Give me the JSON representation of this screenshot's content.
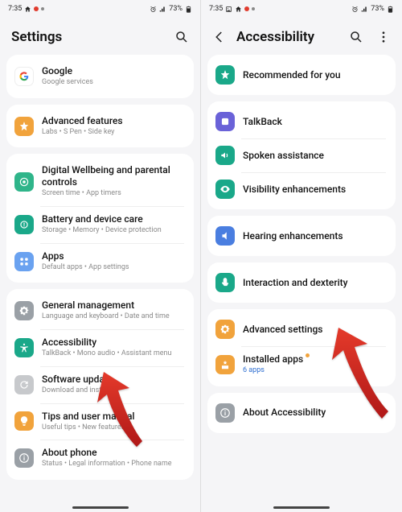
{
  "status": {
    "time": "7:35",
    "battery": "73%"
  },
  "left": {
    "header": {
      "title": "Settings"
    },
    "groups": [
      {
        "rows": [
          {
            "icon": "google-icon",
            "bg": "bg-white",
            "title": "Google",
            "sub": "Google services"
          }
        ]
      },
      {
        "rows": [
          {
            "icon": "star-icon",
            "bg": "bg-orange",
            "title": "Advanced features",
            "sub": "Labs  •  S Pen  •  Side key"
          }
        ]
      },
      {
        "rows": [
          {
            "icon": "wellbeing-icon",
            "bg": "bg-green",
            "title": "Digital Wellbeing and parental controls",
            "sub": "Screen time  •  App timers"
          },
          {
            "icon": "battery-icon",
            "bg": "bg-teal",
            "title": "Battery and device care",
            "sub": "Storage  •  Memory  •  Device protection"
          },
          {
            "icon": "apps-icon",
            "bg": "bg-bluel",
            "title": "Apps",
            "sub": "Default apps  •  App settings"
          }
        ]
      },
      {
        "rows": [
          {
            "icon": "gear-icon",
            "bg": "bg-gray",
            "title": "General management",
            "sub": "Language and keyboard  •  Date and time"
          },
          {
            "icon": "accessibility-icon",
            "bg": "bg-teal",
            "title": "Accessibility",
            "sub": "TalkBack  •  Mono audio  •  Assistant menu"
          },
          {
            "icon": "update-icon",
            "bg": "bg-grayl",
            "title": "Software update",
            "sub": "Download and install"
          },
          {
            "icon": "tips-icon",
            "bg": "bg-orange",
            "title": "Tips and user manual",
            "sub": "Useful tips  •  New features"
          },
          {
            "icon": "info-icon",
            "bg": "bg-gray",
            "title": "About phone",
            "sub": "Status  •  Legal information  •  Phone name"
          }
        ]
      }
    ]
  },
  "right": {
    "header": {
      "title": "Accessibility"
    },
    "groups": [
      {
        "rows": [
          {
            "icon": "star-icon",
            "bg": "bg-teal",
            "title": "Recommended for you"
          }
        ]
      },
      {
        "rows": [
          {
            "icon": "talkback-icon",
            "bg": "bg-purple",
            "title": "TalkBack"
          },
          {
            "icon": "spoken-icon",
            "bg": "bg-teal",
            "title": "Spoken assistance"
          },
          {
            "icon": "visibility-icon",
            "bg": "bg-teal",
            "title": "Visibility enhancements"
          }
        ]
      },
      {
        "rows": [
          {
            "icon": "hearing-icon",
            "bg": "bg-blue",
            "title": "Hearing enhancements"
          }
        ]
      },
      {
        "rows": [
          {
            "icon": "interaction-icon",
            "bg": "bg-teal",
            "title": "Interaction and dexterity"
          }
        ]
      },
      {
        "rows": [
          {
            "icon": "gear-icon",
            "bg": "bg-orange",
            "title": "Advanced settings"
          },
          {
            "icon": "installed-icon",
            "bg": "bg-orange",
            "title": "Installed apps",
            "subLink": "6 apps",
            "dot": true
          }
        ]
      },
      {
        "rows": [
          {
            "icon": "info-icon",
            "bg": "bg-gray",
            "title": "About Accessibility"
          }
        ]
      }
    ]
  }
}
